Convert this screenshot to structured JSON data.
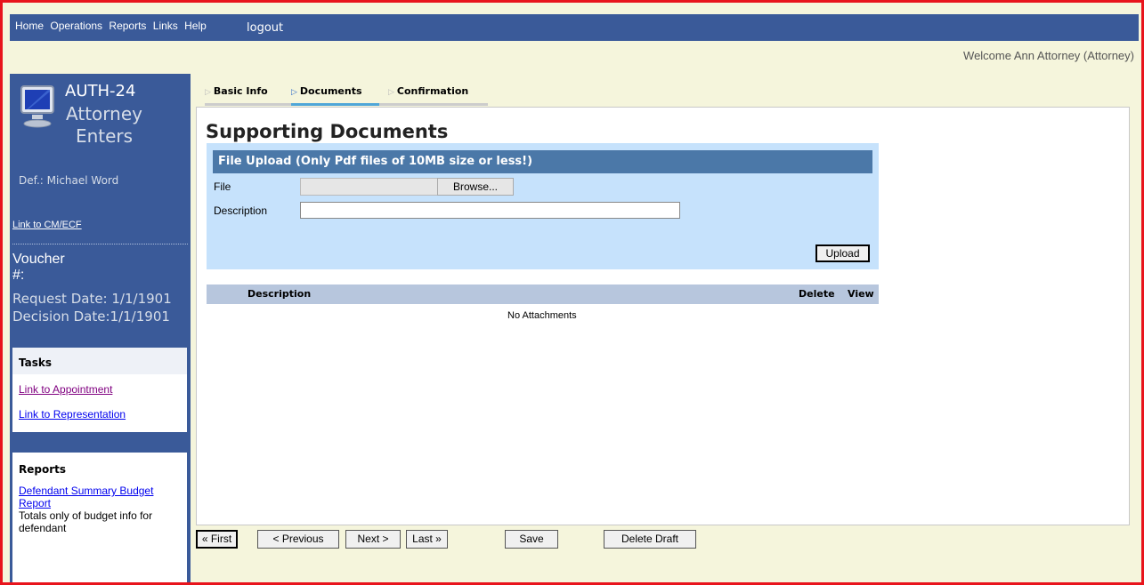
{
  "topnav": {
    "items": [
      "Home",
      "Operations",
      "Reports",
      "Links",
      "Help"
    ],
    "logout": "logout"
  },
  "welcome": "Welcome Ann Attorney (Attorney)",
  "sidebar": {
    "form_code": "AUTH-24",
    "form_name_line1": "Attorney",
    "form_name_line2": "Enters",
    "defendant": "Def.: Michael Word",
    "cmecf_link": "Link to CM/ECF",
    "voucher_line1": "Voucher",
    "voucher_line2": "#:",
    "request_date": "Request Date: 1/1/1901",
    "decision_date": "Decision Date:1/1/1901",
    "tasks": {
      "title": "Tasks",
      "links": [
        "Link to Appointment",
        "Link to Representation"
      ]
    },
    "reports": {
      "title": "Reports",
      "link_line1": "Defendant Summary Budget",
      "link_line2": "Report",
      "note": "Totals only of budget info for defendant"
    }
  },
  "tabs": [
    "Basic Info",
    "Documents",
    "Confirmation"
  ],
  "active_tab": "Documents",
  "main": {
    "title": "Supporting Documents",
    "upload_header": "File Upload (Only Pdf files of 10MB size or less!)",
    "file_label": "File",
    "browse_label": "Browse...",
    "description_label": "Description",
    "upload_button": "Upload",
    "table_headers": {
      "description": "Description",
      "delete": "Delete",
      "view": "View"
    },
    "no_attachments": "No Attachments"
  },
  "nav_buttons": {
    "first": "« First",
    "previous": "< Previous",
    "next": "Next >",
    "last": "Last »",
    "save": "Save",
    "delete_draft": "Delete Draft"
  },
  "colors": {
    "nav_bg": "#3a5a99",
    "frame_border": "#e8141c",
    "page_bg": "#f5f5dc",
    "upload_bg": "#c6e2fc",
    "upload_header": "#4b78a8",
    "visited_link": "#800080",
    "link": "#0000ee"
  },
  "icons": {
    "form_icon": "monitor-icon",
    "tab_arrow": "triangle-right-icon"
  }
}
